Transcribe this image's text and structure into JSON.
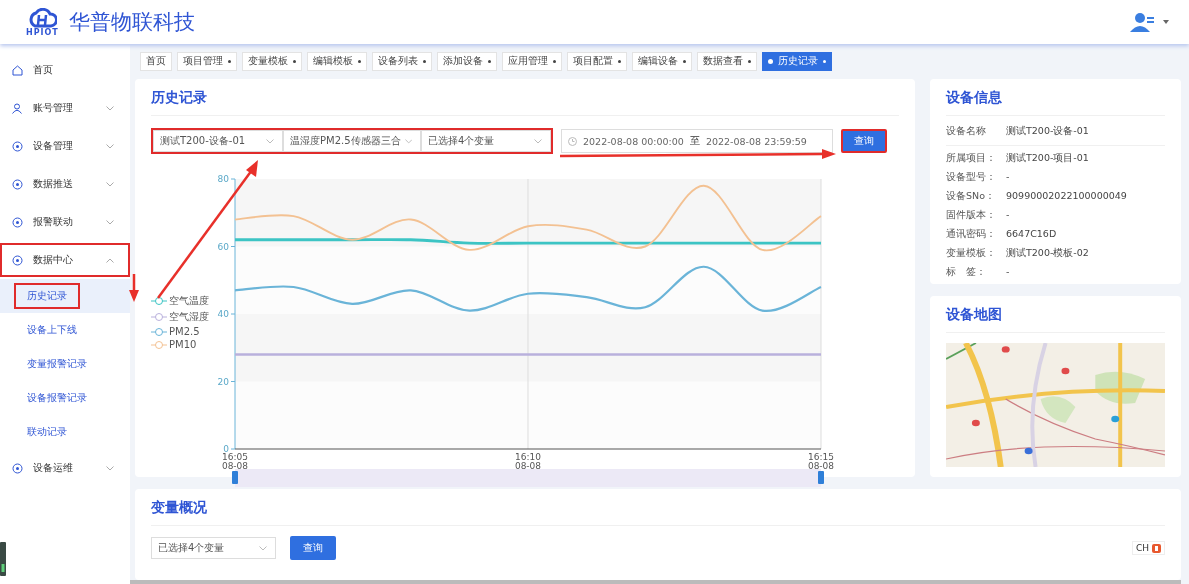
{
  "header": {
    "logo_text": "HPIOT",
    "title": "华普物联科技"
  },
  "tabs": [
    {
      "label": "首页",
      "closable": false,
      "selected": false
    },
    {
      "label": "项目管理",
      "closable": true,
      "selected": false
    },
    {
      "label": "变量模板",
      "closable": true,
      "selected": false
    },
    {
      "label": "编辑模板",
      "closable": true,
      "selected": false
    },
    {
      "label": "设备列表",
      "closable": true,
      "selected": false
    },
    {
      "label": "添加设备",
      "closable": true,
      "selected": false
    },
    {
      "label": "应用管理",
      "closable": true,
      "selected": false
    },
    {
      "label": "项目配置",
      "closable": true,
      "selected": false
    },
    {
      "label": "编辑设备",
      "closable": true,
      "selected": false
    },
    {
      "label": "数据查看",
      "closable": true,
      "selected": false
    },
    {
      "label": "历史记录",
      "closable": true,
      "selected": true
    }
  ],
  "sidebar": {
    "items": [
      {
        "label": "首页",
        "kind": "link",
        "highlighted": false
      },
      {
        "label": "账号管理",
        "kind": "group",
        "expanded": false,
        "highlighted": false
      },
      {
        "label": "设备管理",
        "kind": "group",
        "expanded": false,
        "highlighted": false
      },
      {
        "label": "数据推送",
        "kind": "group",
        "expanded": false,
        "highlighted": false
      },
      {
        "label": "报警联动",
        "kind": "group",
        "expanded": false,
        "highlighted": false
      },
      {
        "label": "数据中心",
        "kind": "group",
        "expanded": true,
        "highlighted": true,
        "children": [
          {
            "label": "历史记录",
            "selected": true,
            "highlighted": true
          },
          {
            "label": "设备上下线",
            "selected": false,
            "highlighted": false
          },
          {
            "label": "变量报警记录",
            "selected": false,
            "highlighted": false
          },
          {
            "label": "设备报警记录",
            "selected": false,
            "highlighted": false
          },
          {
            "label": "联动记录",
            "selected": false,
            "highlighted": false
          }
        ]
      },
      {
        "label": "设备运维",
        "kind": "group",
        "expanded": false,
        "highlighted": false
      }
    ]
  },
  "history": {
    "title": "历史记录",
    "filters": {
      "highlighted": true,
      "device": "测试T200-设备-01",
      "sensor": "温湿度PM2.5传感器三合",
      "variables": "已选择4个变量"
    },
    "date_start": "2022-08-08 00:00:00",
    "date_separator": "至",
    "date_end": "2022-08-08 23:59:59",
    "query_button": {
      "label": "查询",
      "highlighted": true
    },
    "chart_data": {
      "type": "line",
      "legend": "left",
      "categories": [
        "16:05 08-08",
        null,
        null,
        null,
        null,
        "16:10 08-08",
        null,
        null,
        null,
        null,
        "16:15 08-08"
      ],
      "ylim": [
        0,
        80
      ],
      "yticks": [
        0,
        20,
        40,
        60,
        80
      ],
      "series": [
        {
          "name": "空气温度",
          "color": "#3cc4c4",
          "values": [
            62,
            62,
            62,
            62,
            61,
            61,
            61,
            61,
            61,
            61,
            61
          ]
        },
        {
          "name": "空气湿度",
          "color": "#b9b0dc",
          "values": [
            28,
            28,
            28,
            28,
            28,
            28,
            28,
            28,
            28,
            28,
            28
          ]
        },
        {
          "name": "PM2.5",
          "color": "#6ab4d8",
          "values": [
            47,
            48,
            43,
            47,
            41,
            46,
            45,
            42,
            54,
            41,
            48
          ]
        },
        {
          "name": "PM10",
          "color": "#f3c192",
          "values": [
            68,
            69,
            62,
            68,
            59,
            66,
            65,
            60,
            78,
            59,
            69
          ]
        }
      ]
    }
  },
  "device_info": {
    "title": "设备信息",
    "fields": [
      {
        "label": "设备名称",
        "value": "测试T200-设备-01"
      },
      {
        "label": "所属项目：",
        "value": "测试T200-项目-01"
      },
      {
        "label": "设备型号：",
        "value": "-"
      },
      {
        "label": "设备SNo：",
        "value": "90990002022100000049"
      },
      {
        "label": "固件版本：",
        "value": "-"
      },
      {
        "label": "通讯密码：",
        "value": "6647C16D"
      },
      {
        "label": "变量模板：",
        "value": "测试T200-模板-02"
      },
      {
        "label": "标　签：",
        "value": "-"
      }
    ]
  },
  "device_map": {
    "title": "设备地图",
    "kind": "picture"
  },
  "overview": {
    "title": "变量概况",
    "variables": "已选择4个变量",
    "query_button": "查询"
  },
  "ime": {
    "label": "CH"
  }
}
